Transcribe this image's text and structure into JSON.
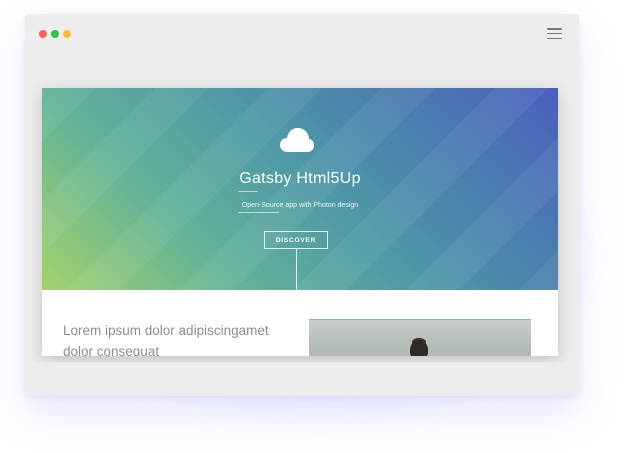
{
  "window": {
    "traffic_lights": [
      "red",
      "green",
      "yellow"
    ],
    "menu_icon": "hamburger-menu-icon"
  },
  "hero": {
    "icon": "cloud-icon",
    "title": "Gatsby Html5Up",
    "subtitle": "Open-Source app with Photon design",
    "button_label": "DISCOVER",
    "gradient_colors": [
      "#a4d26c",
      "#62b398",
      "#4e9aa6",
      "#4a7bb1",
      "#4a5fbf"
    ]
  },
  "content": {
    "heading": "Lorem ipsum dolor adipiscingamet dolor consequat"
  }
}
